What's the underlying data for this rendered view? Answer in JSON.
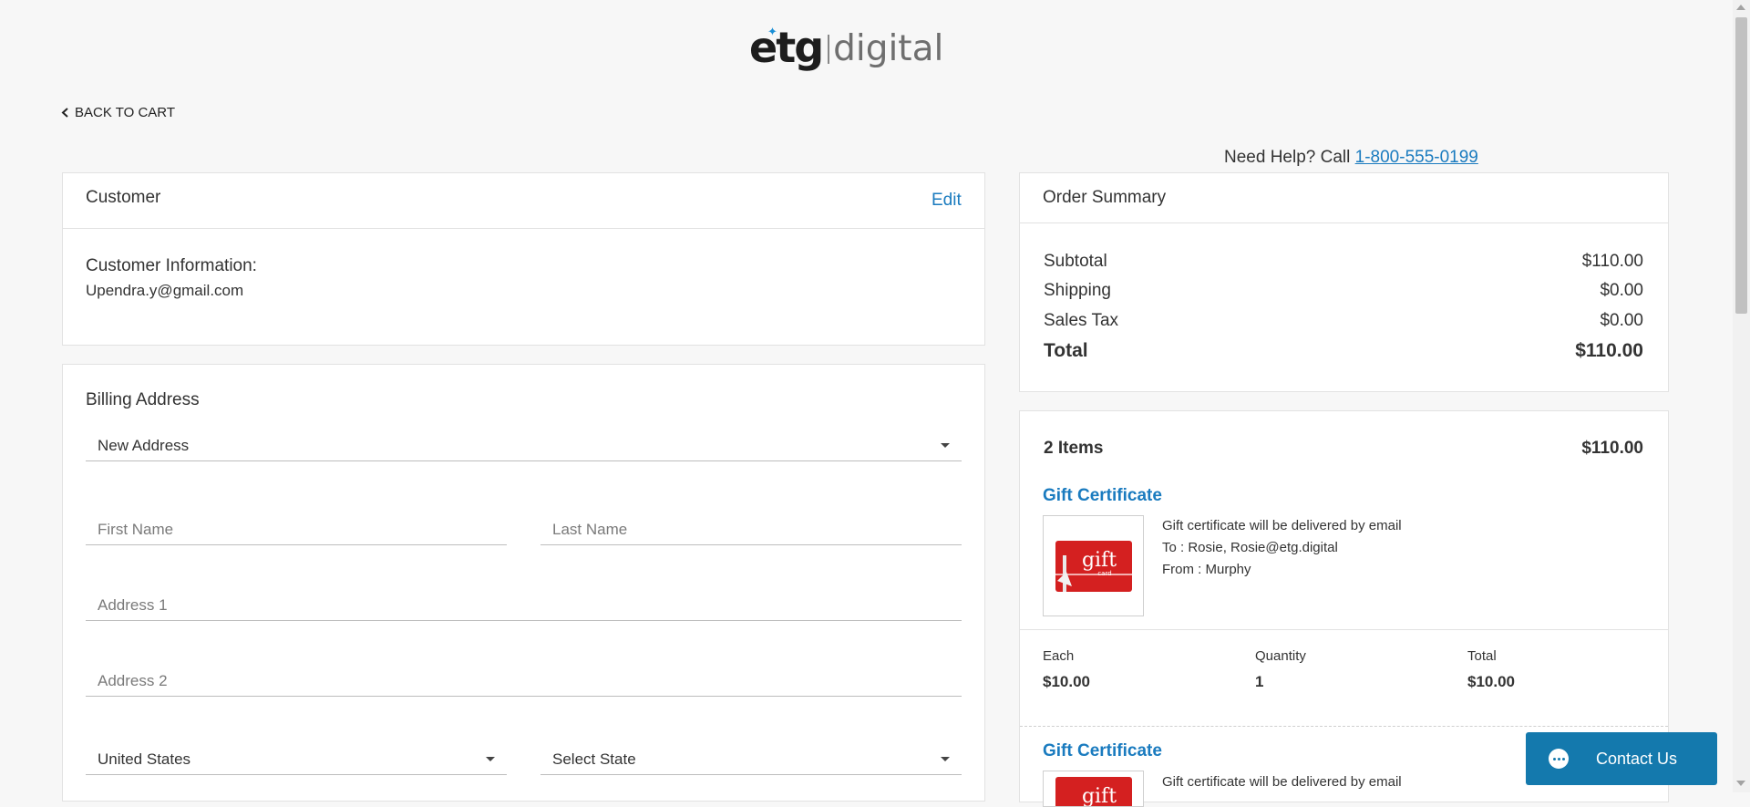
{
  "brand": {
    "part1": "etg",
    "part2": "digital"
  },
  "nav": {
    "back_label": "BACK TO CART"
  },
  "help": {
    "text": "Need Help? Call ",
    "phone": "1-800-555-0199"
  },
  "customer": {
    "title": "Customer",
    "edit_label": "Edit",
    "info_label": "Customer Information:",
    "email": "Upendra.y@gmail.com"
  },
  "billing": {
    "title": "Billing Address",
    "address_select": "New Address",
    "first_name_placeholder": "First Name",
    "last_name_placeholder": "Last Name",
    "address1_placeholder": "Address 1",
    "address2_placeholder": "Address 2",
    "country_select": "United States",
    "state_select": "Select State"
  },
  "summary": {
    "title": "Order Summary",
    "rows": [
      {
        "label": "Subtotal",
        "value": "$110.00"
      },
      {
        "label": "Shipping",
        "value": "$0.00"
      },
      {
        "label": "Sales Tax",
        "value": "$0.00"
      }
    ],
    "total_label": "Total",
    "total_value": "$110.00"
  },
  "items": {
    "count_label": "2 Items",
    "total": "$110.00",
    "list": [
      {
        "name": "Gift Certificate",
        "image_text": "gift",
        "image_subtext": "card",
        "desc_line1": "Gift certificate will be delivered by email",
        "desc_line2": "To : Rosie, Rosie@etg.digital",
        "desc_line3": "From : Murphy",
        "each_label": "Each",
        "each_value": "$10.00",
        "qty_label": "Quantity",
        "qty_value": "1",
        "total_label": "Total",
        "total_value": "$10.00"
      },
      {
        "name": "Gift Certificate",
        "image_text": "gift",
        "desc_line1": "Gift certificate will be delivered by email"
      }
    ]
  },
  "chat": {
    "label": "Contact Us"
  },
  "colors": {
    "accent": "#1a7bbf",
    "chat_bg": "#1479ad",
    "gift_red": "#d42020"
  }
}
